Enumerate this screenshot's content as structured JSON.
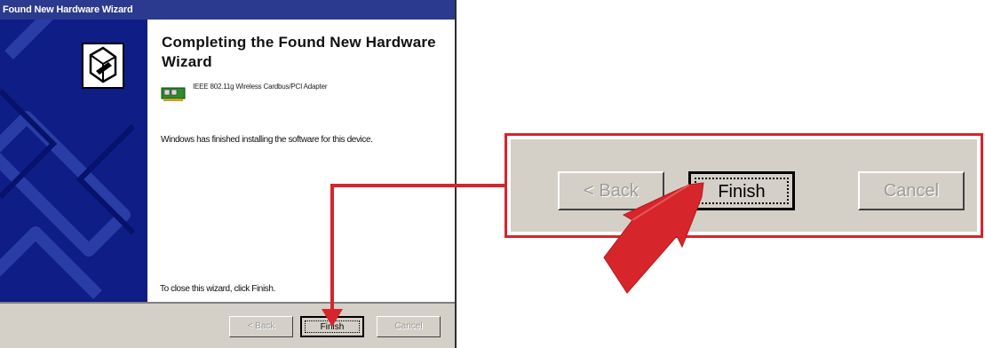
{
  "wizard": {
    "title": "Found New Hardware Wizard",
    "heading": "Completing the Found New Hardware Wizard",
    "device_name": "IEEE 802.11g Wireless Cardbus/PCI Adapter",
    "finished_message": "Windows has finished installing the software for this device.",
    "close_message": "To close this wizard, click Finish.",
    "buttons": {
      "back": "< Back",
      "finish": "Finish",
      "cancel": "Cancel"
    }
  },
  "callout": {
    "buttons": {
      "back": "< Back",
      "finish": "Finish",
      "cancel": "Cancel"
    }
  },
  "colors": {
    "titlebar": "#2b3a8e",
    "side_panel": "#0f1d86",
    "dialog_face": "#d4d0c8",
    "annotation_red": "#d6252b"
  },
  "icons": [
    "hardware-wizard-icon",
    "network-card-icon",
    "pointer-arrow-icon"
  ]
}
